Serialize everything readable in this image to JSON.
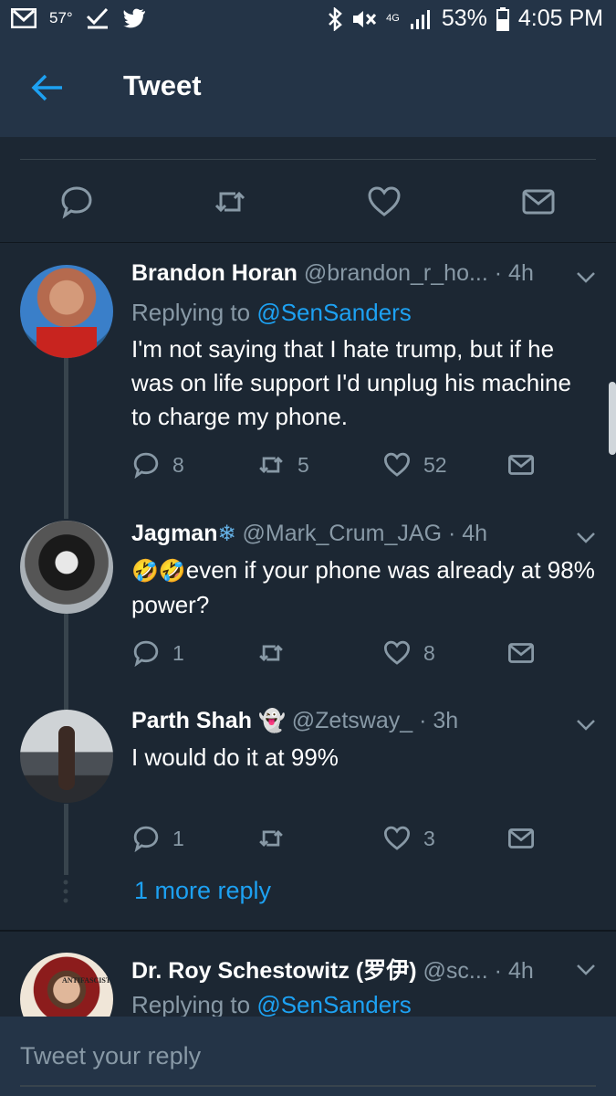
{
  "status_bar": {
    "temperature": "57°",
    "network_label": "4G",
    "battery": "53%",
    "time": "4:05 PM"
  },
  "app_bar": {
    "title": "Tweet"
  },
  "replies": [
    {
      "name": "Brandon Horan",
      "handle": "@brandon_r_ho...",
      "time": "· 4h",
      "replying_prefix": "Replying to",
      "replying_to": "@SenSanders",
      "text": "I'm not saying that I hate trump, but if he was on life support I'd unplug his machine to charge my phone.",
      "replies_count": "8",
      "retweets_count": "5",
      "likes_count": "52"
    },
    {
      "name": "Jagman",
      "name_emoji": "❄",
      "handle": "@Mark_Crum_JAG",
      "time": "· 4h",
      "text_emoji": "🤣🤣",
      "text": "even if your phone was already at 98% power?",
      "replies_count": "1",
      "retweets_count": "",
      "likes_count": "8"
    },
    {
      "name": "Parth Shah",
      "name_emoji": "👻",
      "handle": "@Zetsway_",
      "time": "· 3h",
      "text": "I would do it at 99%",
      "replies_count": "1",
      "retweets_count": "",
      "likes_count": "3"
    },
    {
      "name": "Dr. Roy Schestowitz (罗伊)",
      "handle": "@sc...",
      "time": "· 4h",
      "replying_prefix": "Replying to",
      "replying_to": "@SenSanders",
      "avatar_text": "ANTIFASCIST"
    }
  ],
  "more_replies": "1 more reply",
  "composer": {
    "placeholder": "Tweet your reply"
  },
  "colors": {
    "background": "#1c2733",
    "bar": "#243447",
    "accent": "#1da1f2",
    "muted": "#8899a6"
  },
  "icons": [
    "mail-icon",
    "check-icon",
    "twitter-bird-icon",
    "bluetooth-icon",
    "mute-icon",
    "signal-icon",
    "battery-icon",
    "back-arrow-icon",
    "reply-icon",
    "retweet-icon",
    "like-icon",
    "dm-icon",
    "chevron-down-icon"
  ]
}
